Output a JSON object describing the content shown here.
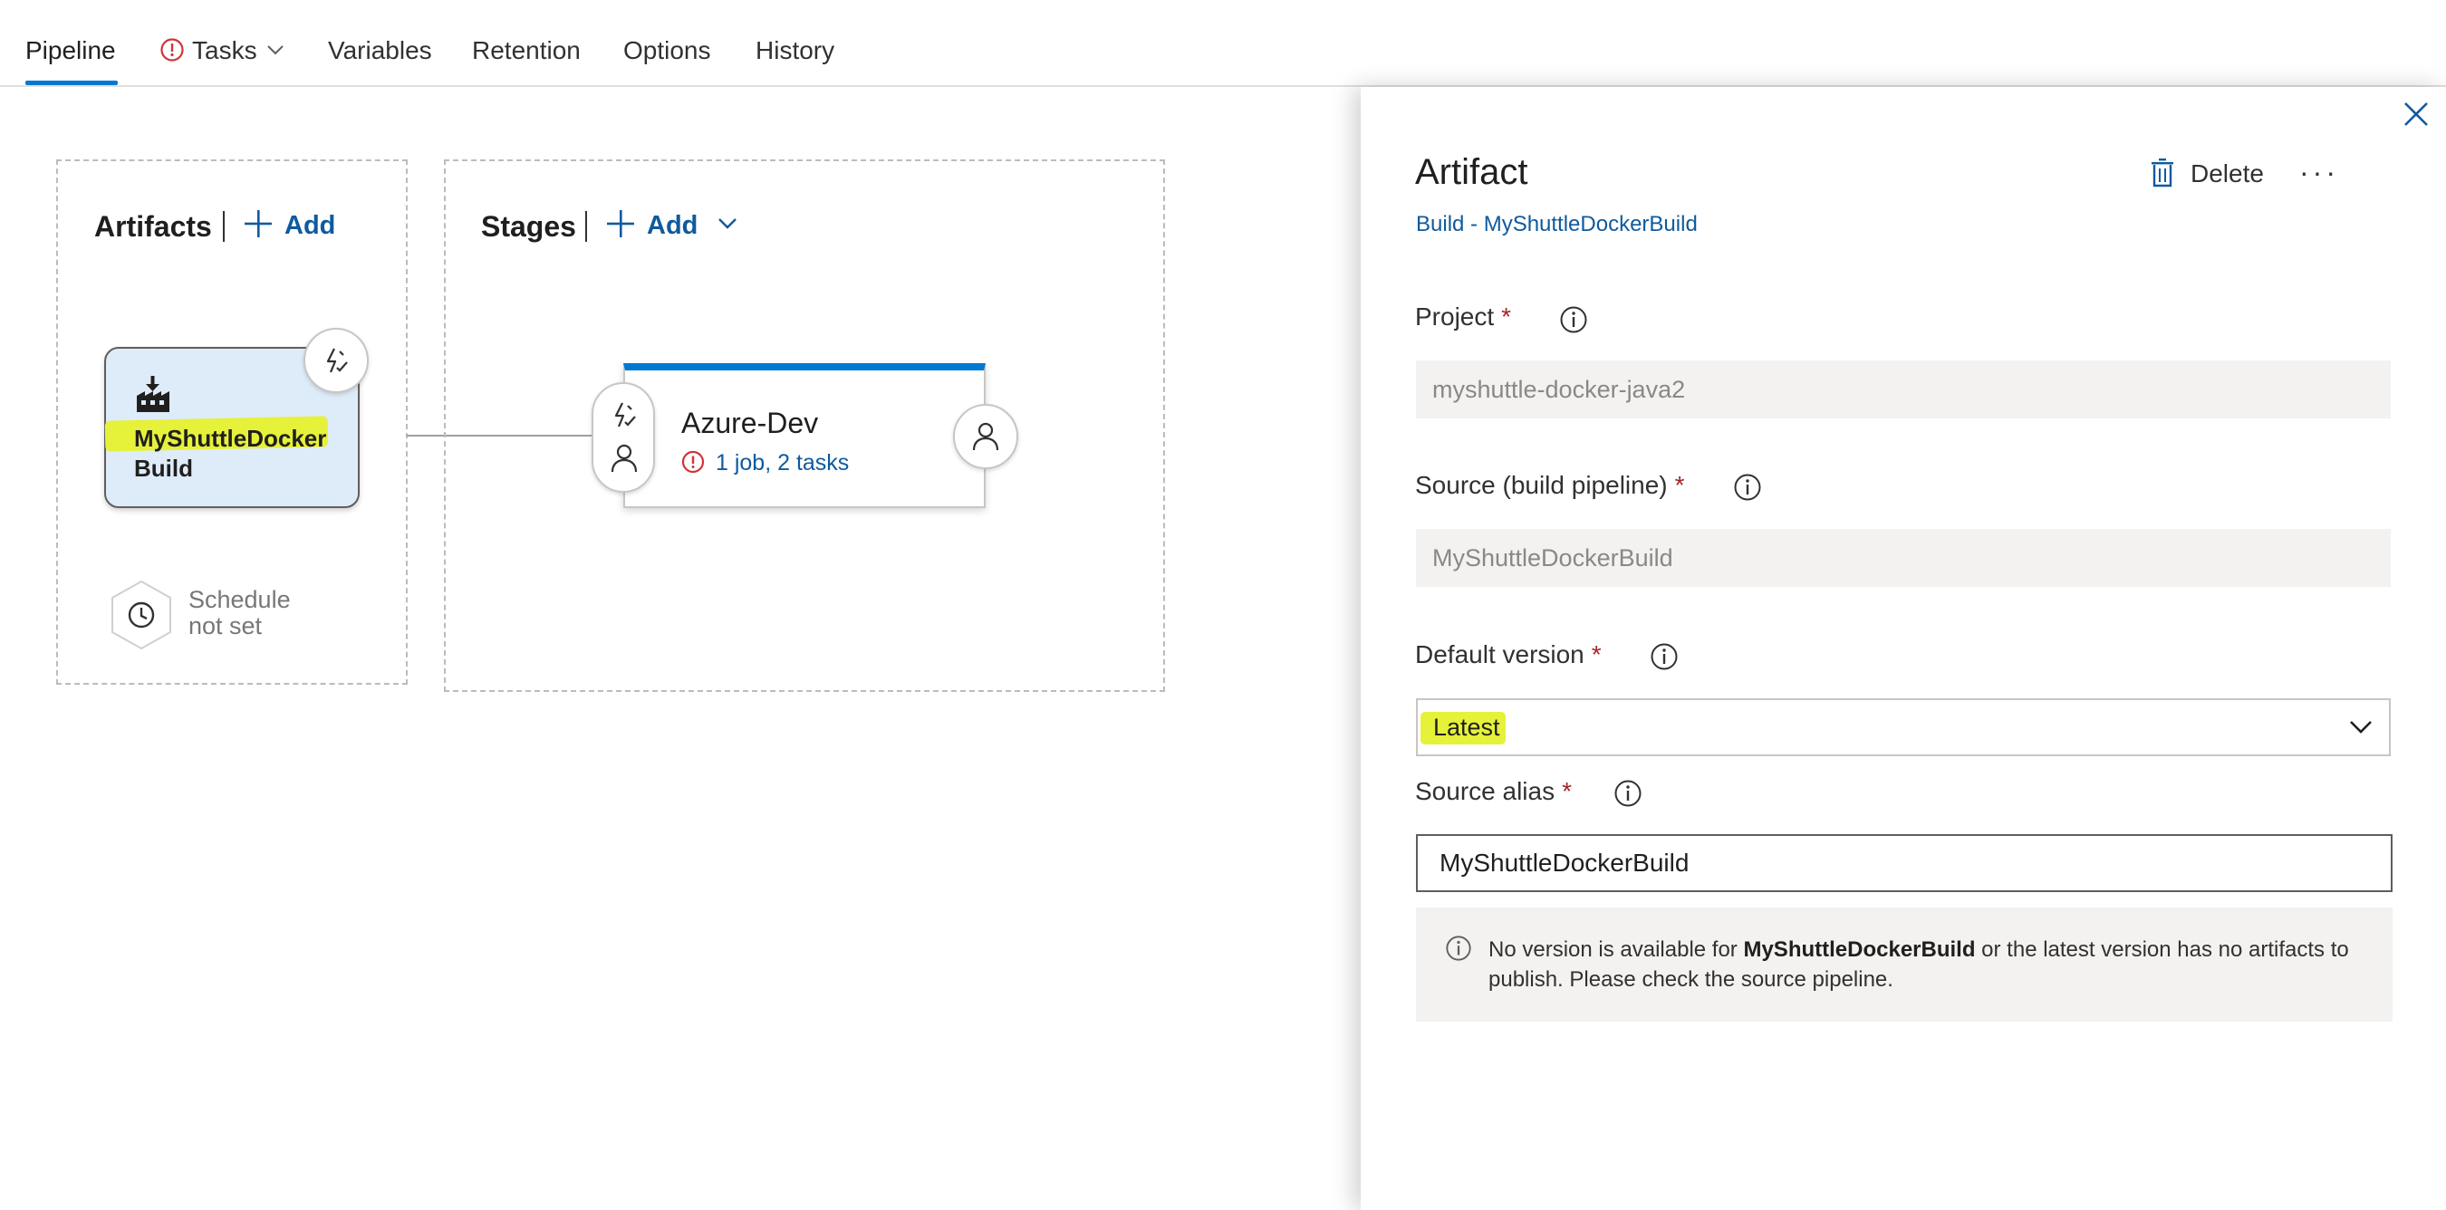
{
  "tabs": [
    {
      "label": "Pipeline",
      "active": true
    },
    {
      "label": "Tasks",
      "warning": true,
      "has_dropdown": true
    },
    {
      "label": "Variables"
    },
    {
      "label": "Retention"
    },
    {
      "label": "Options"
    },
    {
      "label": "History"
    }
  ],
  "artifacts": {
    "title": "Artifacts",
    "add_label": "Add",
    "card": {
      "name_line1": "MyShuttleDocker",
      "name_line2": "Build",
      "icon": "build-factory-icon",
      "trigger_icon": "lightning-icon"
    },
    "schedule": {
      "line1": "Schedule",
      "line2": "not set",
      "icon": "clock-icon"
    }
  },
  "stages": {
    "title": "Stages",
    "add_label": "Add",
    "card": {
      "name": "Azure-Dev",
      "summary": "1 job, 2 tasks",
      "pre_icons": [
        "lightning-icon",
        "person-icon"
      ],
      "post_icon": "person-icon"
    }
  },
  "panel": {
    "title": "Artifact",
    "subtitle": "Build - MyShuttleDockerBuild",
    "delete_label": "Delete",
    "more_label": "···",
    "fields": {
      "project": {
        "label": "Project",
        "required": "*",
        "value": "myshuttle-docker-java2"
      },
      "source": {
        "label": "Source (build pipeline)",
        "required": "*",
        "value": "MyShuttleDockerBuild"
      },
      "default_version": {
        "label": "Default version",
        "required": "*",
        "value": "Latest"
      },
      "source_alias": {
        "label": "Source alias",
        "required": "*",
        "value": "MyShuttleDockerBuild"
      }
    },
    "notice": {
      "prefix": "No version is available for ",
      "bold": "MyShuttleDockerBuild",
      "suffix": " or the latest version has no artifacts to publish. Please check the source pipeline."
    }
  },
  "colors": {
    "accent": "#0078d4",
    "link": "#0f5a9e",
    "highlight": "#e6f13a",
    "required": "#a4262c",
    "warning": "#d13438"
  }
}
